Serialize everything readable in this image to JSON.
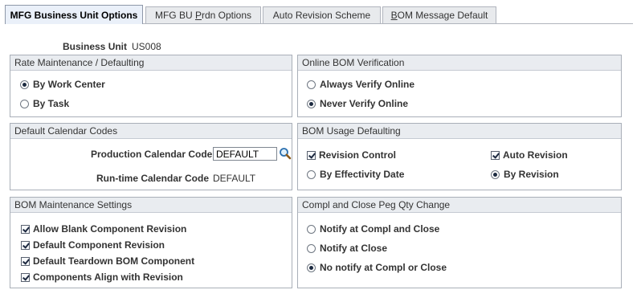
{
  "tabs": [
    {
      "label": "MFG Business Unit Options",
      "active": true
    },
    {
      "label_pre": "MFG BU ",
      "label_ul": "P",
      "label_post": "rdn Options"
    },
    {
      "label": "Auto Revision Scheme"
    },
    {
      "label_ul": "B",
      "label_post": "OM Message Default"
    }
  ],
  "business_unit": {
    "label": "Business Unit",
    "value": "US008"
  },
  "rate_maintenance": {
    "title": "Rate Maintenance / Defaulting",
    "options": [
      {
        "label": "By Work Center",
        "selected": true
      },
      {
        "label": "By Task",
        "selected": false
      }
    ]
  },
  "online_bom": {
    "title": "Online BOM Verification",
    "options": [
      {
        "label": "Always Verify Online",
        "selected": false
      },
      {
        "label": "Never Verify Online",
        "selected": true
      }
    ]
  },
  "calendar": {
    "title": "Default Calendar Codes",
    "production_label": "Production Calendar Code",
    "production_value": "DEFAULT",
    "runtime_label": "Run-time Calendar Code",
    "runtime_value": "DEFAULT"
  },
  "bom_usage": {
    "title": "BOM Usage Defaulting",
    "revision_control": {
      "label": "Revision Control",
      "checked": true
    },
    "auto_revision": {
      "label": "Auto Revision",
      "checked": true
    },
    "by_effectivity": {
      "label": "By Effectivity Date",
      "selected": false
    },
    "by_revision": {
      "label": "By Revision",
      "selected": true
    }
  },
  "bom_maintenance": {
    "title": "BOM Maintenance Settings",
    "items": [
      {
        "label": "Allow Blank Component Revision",
        "checked": true
      },
      {
        "label": "Default Component Revision",
        "checked": true
      },
      {
        "label": "Default Teardown BOM Component",
        "checked": true
      },
      {
        "label": "Components Align with Revision",
        "checked": true
      }
    ]
  },
  "compl_close": {
    "title": "Compl and Close Peg Qty Change",
    "options": [
      {
        "label": "Notify at Compl and Close",
        "selected": false
      },
      {
        "label": "Notify at Close",
        "selected": false
      },
      {
        "label": "No notify at Compl or Close",
        "selected": true
      }
    ]
  },
  "icons": {
    "lookup": "magnifier-icon"
  },
  "colors": {
    "group_header_bg": "#e9ecf0",
    "border": "#a9afb8",
    "active_tab_bg": "#eaf0f9"
  }
}
